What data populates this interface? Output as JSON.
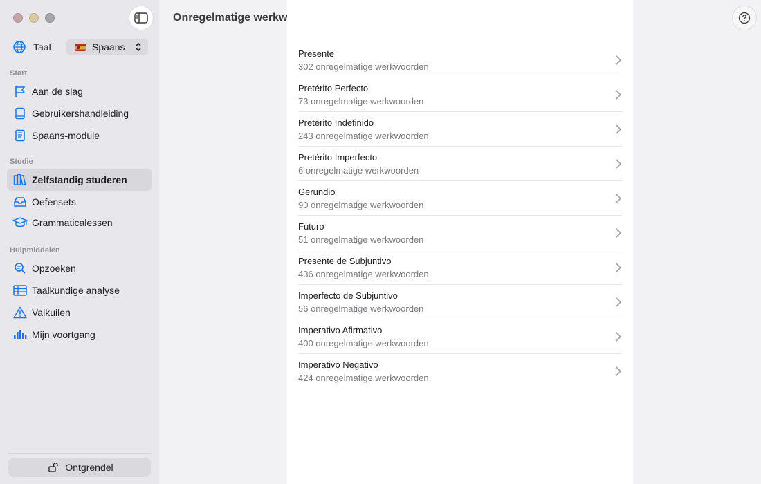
{
  "sidebar": {
    "language_label": "Taal",
    "language_value": "Spaans",
    "sections": {
      "start": "Start",
      "studie": "Studie",
      "hulpmiddelen": "Hulpmiddelen"
    },
    "items": [
      {
        "label": "Aan de slag",
        "icon": "flag-icon"
      },
      {
        "label": "Gebruikershandleiding",
        "icon": "book-icon"
      },
      {
        "label": "Spaans-module",
        "icon": "notebook-icon"
      },
      {
        "label": "Zelfstandig studeren",
        "icon": "books-icon",
        "active": true
      },
      {
        "label": "Oefensets",
        "icon": "tray-icon"
      },
      {
        "label": "Grammaticalessen",
        "icon": "graduation-cap-icon"
      },
      {
        "label": "Opzoeken",
        "icon": "magnifier-icon"
      },
      {
        "label": "Taalkundige analyse",
        "icon": "table-icon"
      },
      {
        "label": "Valkuilen",
        "icon": "warning-icon"
      },
      {
        "label": "Mijn voortgang",
        "icon": "bar-chart-icon"
      }
    ],
    "unlock_label": "Ontgrendel"
  },
  "main": {
    "title": "Onregelmatige werkwoorden",
    "rows": [
      {
        "title": "Presente",
        "subtitle": "302 onregelmatige werkwoorden"
      },
      {
        "title": "Pretérito Perfecto",
        "subtitle": "73 onregelmatige werkwoorden"
      },
      {
        "title": "Pretérito Indefinido",
        "subtitle": "243 onregelmatige werkwoorden"
      },
      {
        "title": "Pretérito Imperfecto",
        "subtitle": "6 onregelmatige werkwoorden"
      },
      {
        "title": "Gerundio",
        "subtitle": "90 onregelmatige werkwoorden"
      },
      {
        "title": "Futuro",
        "subtitle": "51 onregelmatige werkwoorden"
      },
      {
        "title": "Presente de Subjuntivo",
        "subtitle": "436 onregelmatige werkwoorden"
      },
      {
        "title": "Imperfecto de Subjuntivo",
        "subtitle": "56 onregelmatige werkwoorden"
      },
      {
        "title": "Imperativo Afirmativo",
        "subtitle": "400 onregelmatige werkwoorden"
      },
      {
        "title": "Imperativo Negativo",
        "subtitle": "424 onregelmatige werkwoorden"
      }
    ]
  },
  "colors": {
    "accent": "#1a73e8",
    "sidebar_bg": "#e8e8ec",
    "content_bg": "#ffffff"
  }
}
